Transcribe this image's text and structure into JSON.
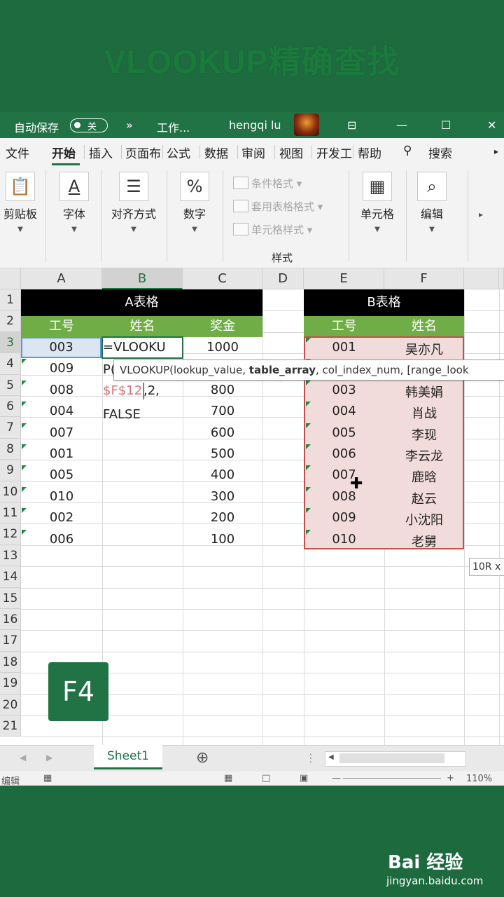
{
  "banner": {
    "title": "VLOOKUP精确查找"
  },
  "titlebar": {
    "autosave_label": "自动保存",
    "autosave_state": "关",
    "more": "»",
    "filename": "工作...",
    "user": "hengqi lu",
    "restore_icon": "⊟",
    "minimize": "—",
    "maximize": "☐",
    "close": "✕"
  },
  "ribbon_tabs": [
    "文件",
    "开始",
    "插入",
    "页面布",
    "公式",
    "数据",
    "审阅",
    "视图",
    "开发工",
    "帮助"
  ],
  "search_label": "搜索",
  "ribbon": {
    "paste": "剪贴板",
    "font": "字体",
    "font_icon": "A",
    "align": "对齐方式",
    "align_icon": "☰",
    "number": "数字",
    "number_icon": "%",
    "cond_format": "条件格式 ▾",
    "table_format": "套用表格格式 ▾",
    "cell_style": "单元格样式 ▾",
    "styles_group": "样式",
    "cells": "单元格",
    "editing": "编辑",
    "editing_icon": "⌕"
  },
  "columns": [
    "A",
    "B",
    "C",
    "D",
    "E",
    "F"
  ],
  "rows": [
    "1",
    "2",
    "3",
    "4",
    "5",
    "6",
    "7",
    "8",
    "9",
    "10",
    "11",
    "12",
    "13",
    "14",
    "15",
    "16",
    "17",
    "18",
    "19",
    "20",
    "21"
  ],
  "table_a": {
    "title": "A表格",
    "headers": [
      "工号",
      "姓名",
      "奖金"
    ],
    "ids": [
      "003",
      "009",
      "008",
      "004",
      "007",
      "001",
      "005",
      "010",
      "002",
      "006"
    ],
    "bonus": [
      "1000",
      "",
      "800",
      "700",
      "600",
      "500",
      "400",
      "300",
      "200",
      "100"
    ]
  },
  "table_b": {
    "title": "B表格",
    "headers": [
      "工号",
      "姓名"
    ],
    "ids": [
      "001",
      "",
      "003",
      "004",
      "005",
      "006",
      "007",
      "008",
      "009",
      "010"
    ],
    "names": [
      "吴亦凡",
      "",
      "韩美娟",
      "肖战",
      "李现",
      "李云龙",
      "鹿晗",
      "赵云",
      "小沈阳",
      "老舅"
    ]
  },
  "formula_edit": {
    "line1": "=VLOOKU",
    "line2": "P(",
    "line3_ref": "$F$12",
    "line3_rest": ",2,",
    "line4": "FALSE"
  },
  "tooltip": {
    "fn": "VLOOKUP(lookup_value, ",
    "bold": "table_array",
    "rest": ", col_index_num, [range_look"
  },
  "size_tip": "10R x",
  "key_hint": "F4",
  "sheet_tab": "Sheet1",
  "add_sheet": "⊕",
  "status": {
    "mode": "编辑",
    "zoom": "110%"
  },
  "watermark": {
    "brand": "Bai 经验",
    "url": "jingyan.baidu.com"
  },
  "colors": {
    "excel_green": "#217346",
    "header_green": "#70ad47",
    "range_pink": "#f2dcdb",
    "range_border": "#c0504d"
  }
}
